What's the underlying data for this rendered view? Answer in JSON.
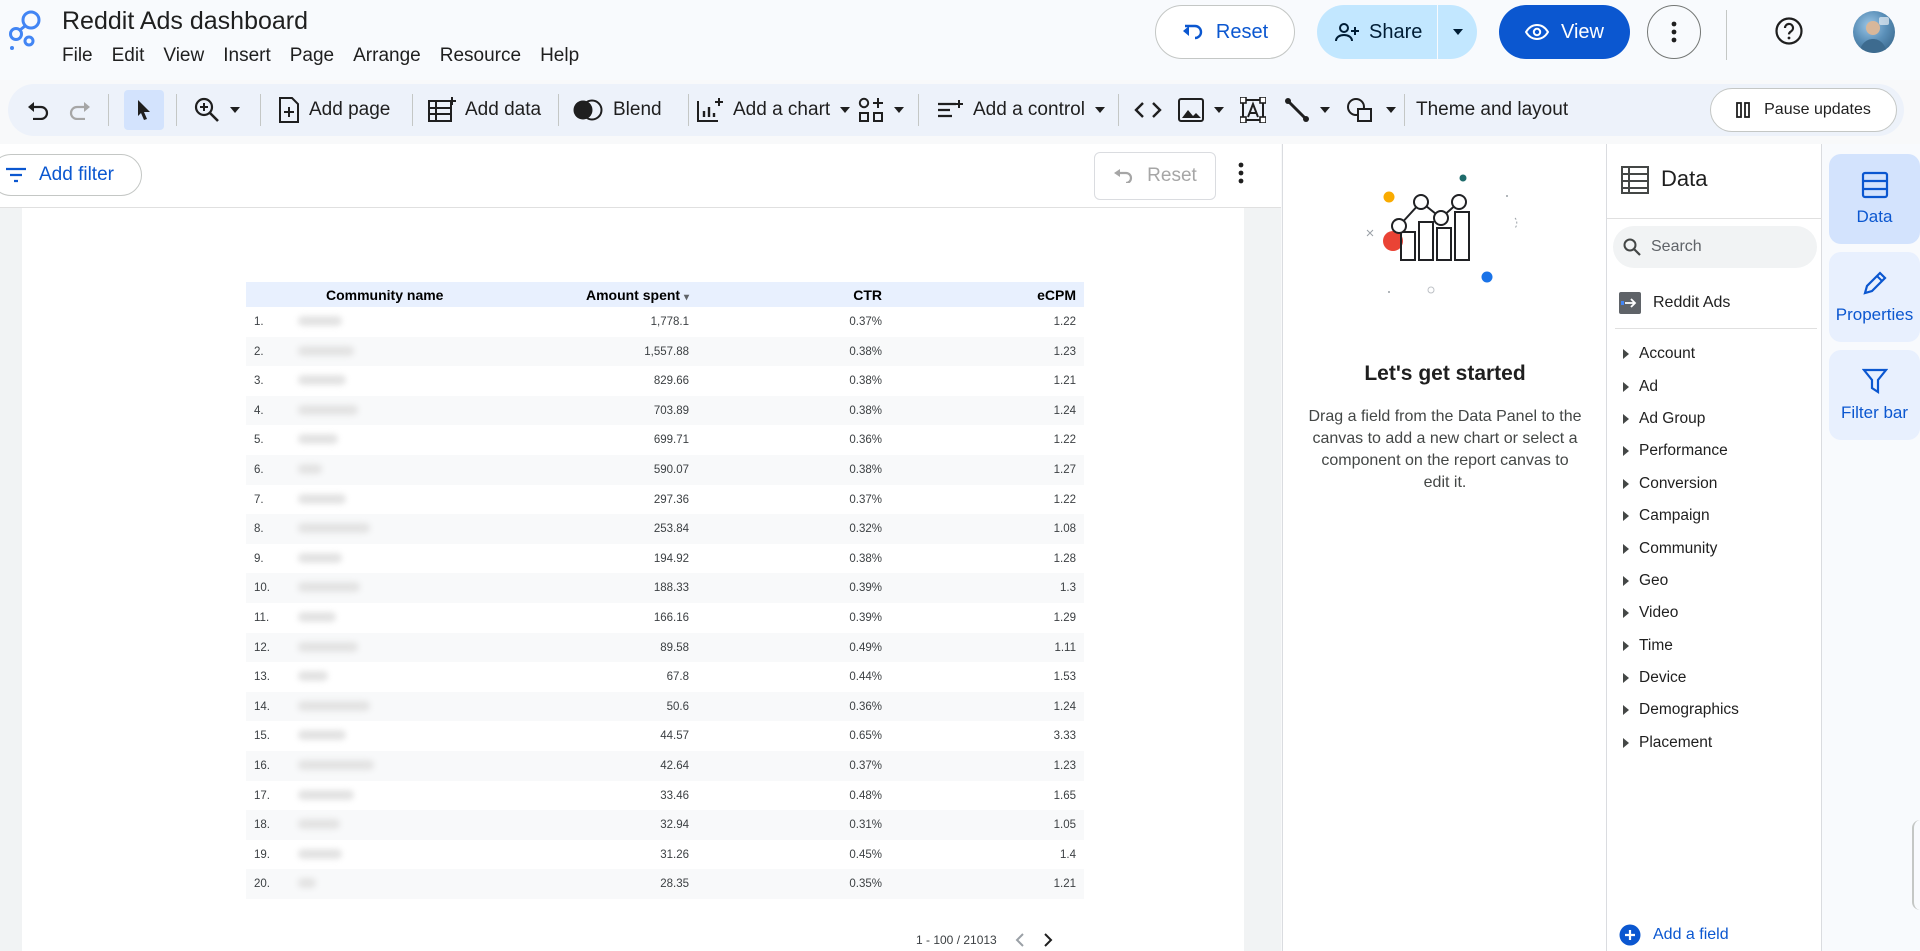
{
  "app": {
    "title": "Reddit Ads dashboard",
    "menu": [
      "File",
      "Edit",
      "View",
      "Insert",
      "Page",
      "Arrange",
      "Resource",
      "Help"
    ],
    "reset_label": "Reset",
    "share_label": "Share",
    "view_label": "View",
    "accent_color": "#0b57d0"
  },
  "toolbar": {
    "add_page": "Add page",
    "add_data": "Add data",
    "blend": "Blend",
    "add_chart": "Add a chart",
    "add_control": "Add a control",
    "theme_layout": "Theme and layout",
    "pause_updates": "Pause updates"
  },
  "canvas": {
    "add_filter": "Add filter",
    "reset_label": "Reset"
  },
  "table": {
    "columns": [
      "Community name",
      "Amount spent",
      "CTR",
      "eCPM"
    ],
    "sort_indicator": "▾",
    "rows": [
      {
        "idx": "1.",
        "amount": "1,778.1",
        "ctr": "0.37%",
        "ecpm": "1.22"
      },
      {
        "idx": "2.",
        "amount": "1,557.88",
        "ctr": "0.38%",
        "ecpm": "1.23"
      },
      {
        "idx": "3.",
        "amount": "829.66",
        "ctr": "0.38%",
        "ecpm": "1.21"
      },
      {
        "idx": "4.",
        "amount": "703.89",
        "ctr": "0.38%",
        "ecpm": "1.24"
      },
      {
        "idx": "5.",
        "amount": "699.71",
        "ctr": "0.36%",
        "ecpm": "1.22"
      },
      {
        "idx": "6.",
        "amount": "590.07",
        "ctr": "0.38%",
        "ecpm": "1.27"
      },
      {
        "idx": "7.",
        "amount": "297.36",
        "ctr": "0.37%",
        "ecpm": "1.22"
      },
      {
        "idx": "8.",
        "amount": "253.84",
        "ctr": "0.32%",
        "ecpm": "1.08"
      },
      {
        "idx": "9.",
        "amount": "194.92",
        "ctr": "0.38%",
        "ecpm": "1.28"
      },
      {
        "idx": "10.",
        "amount": "188.33",
        "ctr": "0.39%",
        "ecpm": "1.3"
      },
      {
        "idx": "11.",
        "amount": "166.16",
        "ctr": "0.39%",
        "ecpm": "1.29"
      },
      {
        "idx": "12.",
        "amount": "89.58",
        "ctr": "0.49%",
        "ecpm": "1.11"
      },
      {
        "idx": "13.",
        "amount": "67.8",
        "ctr": "0.44%",
        "ecpm": "1.53"
      },
      {
        "idx": "14.",
        "amount": "50.6",
        "ctr": "0.36%",
        "ecpm": "1.24"
      },
      {
        "idx": "15.",
        "amount": "44.57",
        "ctr": "0.65%",
        "ecpm": "3.33"
      },
      {
        "idx": "16.",
        "amount": "42.64",
        "ctr": "0.37%",
        "ecpm": "1.23"
      },
      {
        "idx": "17.",
        "amount": "33.46",
        "ctr": "0.48%",
        "ecpm": "1.65"
      },
      {
        "idx": "18.",
        "amount": "32.94",
        "ctr": "0.31%",
        "ecpm": "1.05"
      },
      {
        "idx": "19.",
        "amount": "31.26",
        "ctr": "0.45%",
        "ecpm": "1.4"
      },
      {
        "idx": "20.",
        "amount": "28.35",
        "ctr": "0.35%",
        "ecpm": "1.21"
      }
    ],
    "pagination": "1 - 100 / 21013"
  },
  "get_started": {
    "title": "Let's get started",
    "text": "Drag a field from the Data Panel to the canvas to add a new chart or select a component on the report canvas to edit it."
  },
  "data_panel": {
    "title": "Data",
    "search_placeholder": "Search",
    "source": "Reddit Ads",
    "groups": [
      "Account",
      "Ad",
      "Ad Group",
      "Performance",
      "Conversion",
      "Campaign",
      "Community",
      "Geo",
      "Video",
      "Time",
      "Device",
      "Demographics",
      "Placement"
    ],
    "add_field": "Add a field"
  },
  "rail": {
    "tabs": [
      "Data",
      "Properties",
      "Filter bar"
    ]
  }
}
